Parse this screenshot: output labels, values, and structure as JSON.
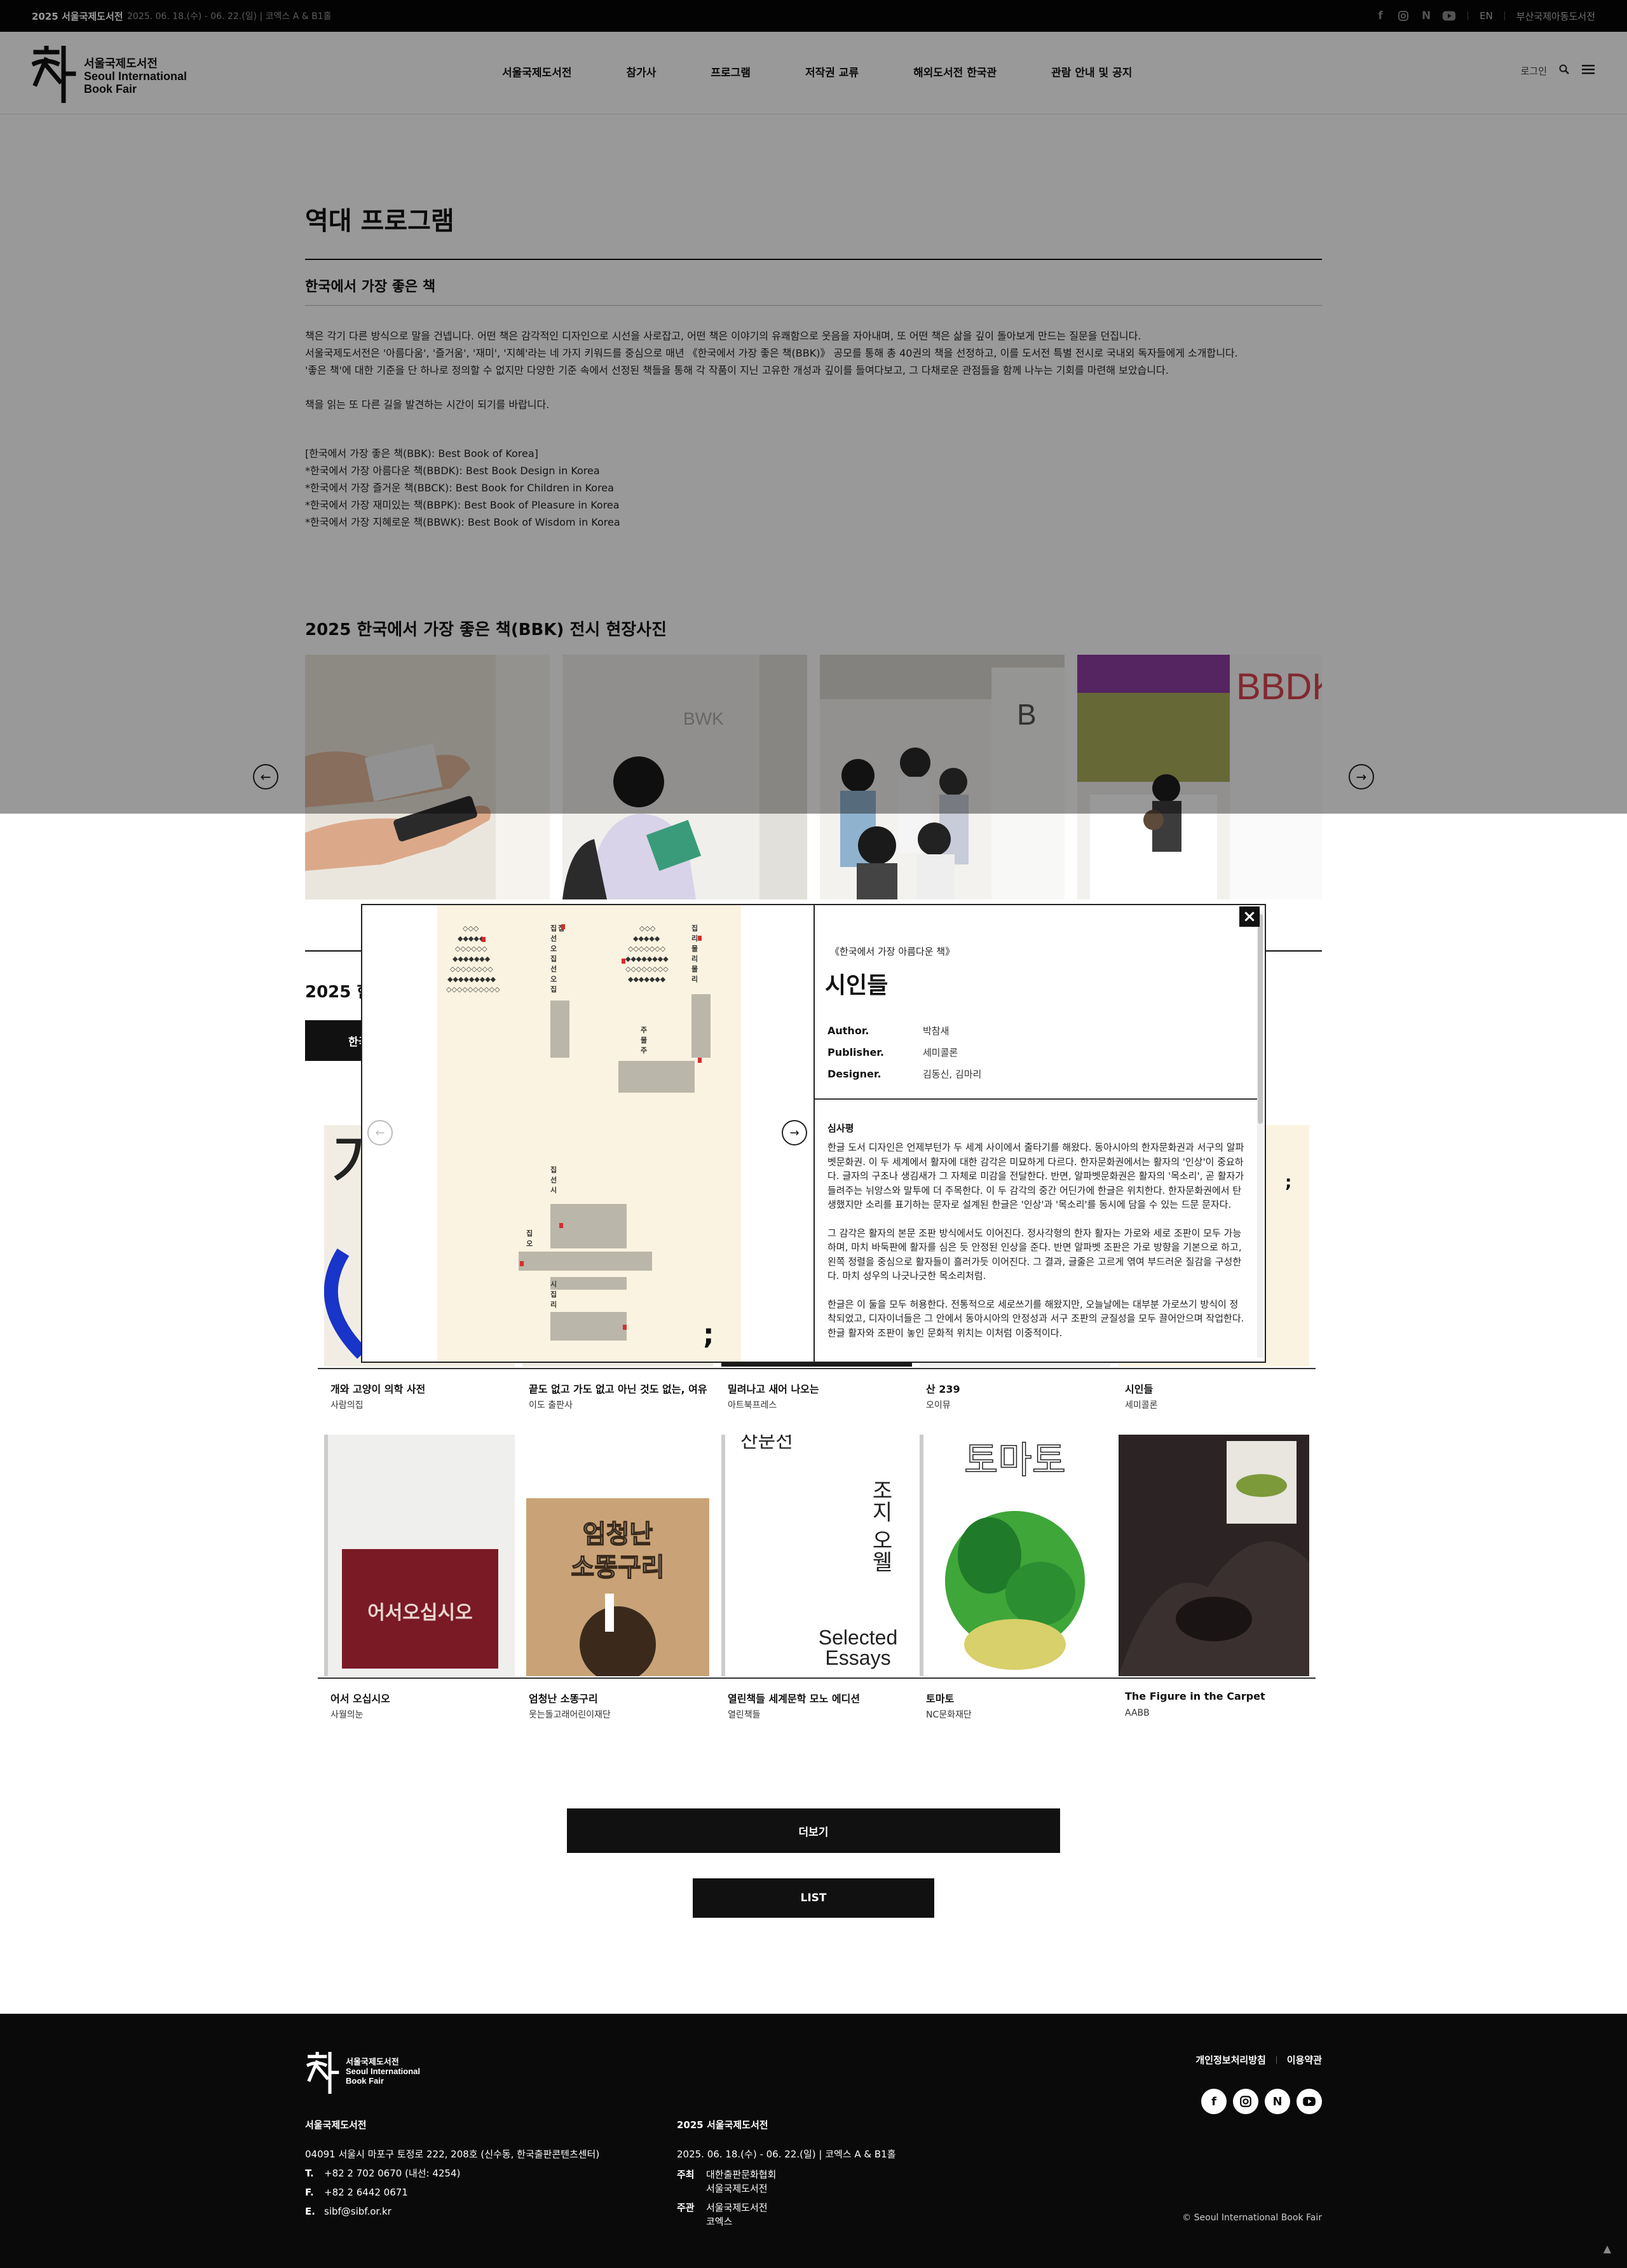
{
  "topbar": {
    "event": "2025 서울국제도서전",
    "date": "2025. 06. 18.(수) - 06. 22.(일) | 코엑스 A & B1홀",
    "lang": "EN",
    "busan": "부산국제아동도서전",
    "social_icons": [
      "facebook-icon",
      "instagram-icon",
      "naver-icon",
      "youtube-icon"
    ]
  },
  "header": {
    "logo_ko": "서울국제도서전",
    "logo_en1": "Seoul International",
    "logo_en2": "Book Fair",
    "nav": [
      "서울국제도서전",
      "참가사",
      "프로그램",
      "저작권 교류",
      "해외도서전 한국관",
      "관람 안내 및 공지"
    ],
    "login": "로그인"
  },
  "main": {
    "page_title": "역대 프로그램",
    "sub_title": "한국에서 가장 좋은 책",
    "intro": [
      "책은 각기 다른 방식으로 말을 건넵니다. 어떤 책은 감각적인 디자인으로 시선을 사로잡고, 어떤 책은 이야기의 유쾌함으로 웃음을 자아내며, 또 어떤 책은 삶을 깊이 돌아보게 만드는 질문을 던집니다.",
      "서울국제도서전은 '아름다움', '즐거움', '재미', '지혜'라는 네 가지 키워드를 중심으로 매년 《한국에서 가장 좋은 책(BBK)》 공모를 통해 총 40권의 책을 선정하고, 이를 도서전 특별 전시로 국내외 독자들에게 소개합니다.",
      "'좋은 책'에 대한 기준을 단 하나로 정의할 수 없지만 다양한 기준 속에서 선정된 책들을 통해 각 작품이 지닌 고유한 개성과 깊이를 들여다보고, 그 다채로운 관점들을 함께 나누는 기회를 마련해 보았습니다.",
      "책을 읽는 또 다른 길을 발견하는 시간이 되기를 바랍니다."
    ],
    "definitions": [
      "[한국에서 가장 좋은 책(BBK): Best Book of Korea]",
      "*한국에서 가장 아름다운 책(BBDK): Best Book Design in Korea",
      "*한국에서 가장 즐거운 책(BBCK): Best Book for Children in Korea",
      "*한국에서 가장 재미있는 책(BBPK): Best Book of Pleasure in Korea",
      "*한국에서 가장 지혜로운 책(BBWK): Best Book of Wisdom in Korea"
    ],
    "gallery_title": "2025 한국에서 가장 좋은 책(BBK) 전시 현장사진",
    "gallery_signs": [
      "BWK",
      "B",
      "BBDK"
    ],
    "section2_title": "2025 한",
    "tab_label": "한국",
    "books_row1": [
      {
        "title": "개와 고양이 의학 사전",
        "publisher": "사람의집"
      },
      {
        "title": "끝도 없고 가도 없고 아닌 것도 없는, 여유",
        "publisher": "이도 출판사"
      },
      {
        "title": "밀려나고 새어 나오는",
        "publisher": "아트북프레스"
      },
      {
        "title": "산 239",
        "publisher": "오이뮤"
      },
      {
        "title": "시인들",
        "publisher": "세미콜론"
      }
    ],
    "books_row2": [
      {
        "title": "어서 오십시오",
        "publisher": "사월의눈",
        "cover_text": "어서오십시오"
      },
      {
        "title": "엄청난 소똥구리",
        "publisher": "웃는돌고래어린이재단",
        "cover_text1": "엄청난",
        "cover_text2": "소똥구리"
      },
      {
        "title": "열린책들 세계문학 모노 에디션",
        "publisher": "열린책들",
        "cover_text1": "산문선",
        "cover_text2": "Selected",
        "cover_text3": "Essays",
        "cover_side": "조지 오웰"
      },
      {
        "title": "토마토",
        "publisher": "NC문화재단",
        "cover_text": "토마토"
      },
      {
        "title": "The Figure in the Carpet",
        "publisher": "AABB"
      }
    ],
    "more_label": "더보기",
    "list_label": "LIST"
  },
  "modal": {
    "category": "《한국에서 가장 아름다운 책》",
    "title": "시인들",
    "author_label": "Author.",
    "author": "박참새",
    "publisher_label": "Publisher.",
    "publisher": "세미콜론",
    "designer_label": "Designer.",
    "designer": "김동신, 김마리",
    "review_heading": "심사평",
    "review": [
      "한글 도서 디자인은 언제부턴가 두 세계 사이에서 줄타기를 해왔다. 동아시아의 한자문화권과 서구의 알파벳문화권. 이 두 세계에서 활자에 대한 감각은 미묘하게 다르다. 한자문화권에서는 활자의 '인상'이 중요하다. 글자의 구조나 생김새가 그 자체로 미감을 전달한다. 반면, 알파벳문화권은 활자의 '목소리', 곧 활자가 들려주는 뉘앙스와 말투에 더 주목한다. 이 두 감각의 중간 어딘가에 한글은 위치한다. 한자문화권에서 탄생했지만 소리를 표기하는 문자로 설계된 한글은 '인상'과 '목소리'를 동시에 담을 수 있는 드문 문자다.",
      "그 감각은 활자의 본문 조판 방식에서도 이어진다. 정사각형의 한자 활자는 가로와 세로 조판이 모두 가능하며, 마치 바둑판에 활자를 심은 듯 안정된 인상을 준다. 반면 알파벳 조판은 가로 방향을 기본으로 하고, 왼쪽 정렬을 중심으로 활자들이 흘러가듯 이어진다. 그 결과, 글줄은 고르게 엮여 부드러운 질감을 구성한다. 마치 성우의 나긋나긋한 목소리처럼.",
      "한글은 이 둘을 모두 허용한다. 전통적으로 세로쓰기를 해왔지만, 오늘날에는 대부분 가로쓰기 방식이 정착되었고, 디자이너들은 그 안에서 동아시아의 안정성과 서구 조판의 균질성을 모두 끌어안으며 작업한다. 한글 활자와 조판이 놓인 문화적 위치는 이처럼 이중적이다."
    ],
    "book_glyphs": [
      "집",
      "선",
      "오",
      "리",
      "물",
      "주",
      "시",
      ";"
    ]
  },
  "footer": {
    "logo_ko": "서울국제도서전",
    "logo_en1": "Seoul International",
    "logo_en2": "Book Fair",
    "links": [
      "개인정보처리방침",
      "이용약관"
    ],
    "social_icons": [
      "facebook-icon",
      "instagram-icon",
      "naver-icon",
      "youtube-icon"
    ],
    "col1_heading": "서울국제도서전",
    "address": "04091 서울시 마포구 토정로 222, 208호 (신수동, 한국출판콘텐츠센터)",
    "tel_label": "T.",
    "tel": "+82 2 702 0670 (내선: 4254)",
    "fax_label": "F.",
    "fax": "+82 2 6442 0671",
    "email_label": "E.",
    "email": "sibf@sibf.or.kr",
    "col2_heading": "2025 서울국제도서전",
    "col2_date": "2025. 06. 18.(수) - 06. 22.(일) | 코엑스 A & B1홀",
    "host_label": "주최",
    "host1": "대한출판문화협회",
    "host2": "서울국제도서전",
    "org_label": "주관",
    "org1": "서울국제도서전",
    "org2": "코엑스",
    "copyright": "© Seoul International Book Fair"
  }
}
